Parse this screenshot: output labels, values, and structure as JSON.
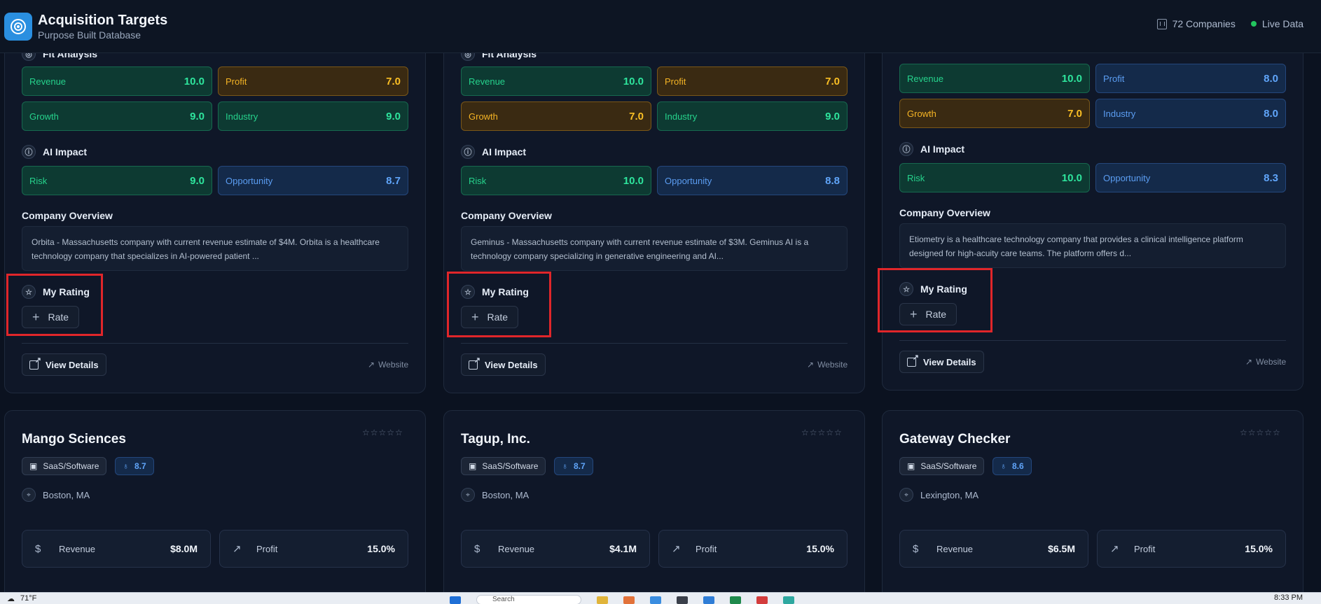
{
  "header": {
    "title": "Acquisition Targets",
    "subtitle": "Purpose Built Database",
    "companies_count": "72 Companies",
    "live_label": "Live Data"
  },
  "labels": {
    "fit_analysis": "Fit Analysis",
    "ai_impact": "AI Impact",
    "company_overview": "Company Overview",
    "my_rating": "My Rating",
    "rate": "Rate",
    "view_details": "View Details",
    "website": "Website",
    "revenue": "Revenue",
    "profit": "Profit",
    "growth": "Growth",
    "industry": "Industry",
    "risk": "Risk",
    "opportunity": "Opportunity"
  },
  "top_cards": [
    {
      "fit": {
        "revenue": "10.0",
        "profit": "7.0",
        "growth": "9.0",
        "industry": "9.0"
      },
      "ai": {
        "risk": "9.0",
        "opportunity": "8.7"
      },
      "overview": "Orbita - Massachusetts company with current revenue estimate of $4M. Orbita is a healthcare technology company that specializes in AI-powered patient ..."
    },
    {
      "fit": {
        "revenue": "10.0",
        "profit": "7.0",
        "growth": "7.0",
        "industry": "9.0"
      },
      "ai": {
        "risk": "10.0",
        "opportunity": "8.8"
      },
      "overview": "Geminus - Massachusetts company with current revenue estimate of $3M. Geminus AI is a technology company specializing in generative engineering and AI..."
    },
    {
      "fit": {
        "revenue": "10.0",
        "profit": "8.0",
        "growth": "7.0",
        "industry": "8.0"
      },
      "ai": {
        "risk": "10.0",
        "opportunity": "8.3"
      },
      "overview": "Etiometry is a healthcare technology company that provides a clinical intelligence platform designed for high-acuity care teams. The platform offers d..."
    }
  ],
  "bottom_cards": [
    {
      "name": "Mango Sciences",
      "sector": "SaaS/Software",
      "score": "8.7",
      "location": "Boston, MA",
      "revenue": "$8.0M",
      "profit": "15.0%"
    },
    {
      "name": "Tagup, Inc.",
      "sector": "SaaS/Software",
      "score": "8.7",
      "location": "Boston, MA",
      "revenue": "$4.1M",
      "profit": "15.0%"
    },
    {
      "name": "Gateway Checker",
      "sector": "SaaS/Software",
      "score": "8.6",
      "location": "Lexington, MA",
      "revenue": "$6.5M",
      "profit": "15.0%"
    }
  ],
  "taskbar": {
    "weather": "71°F",
    "search": "Search",
    "time": "8:33 PM"
  },
  "colors": {
    "green": "#2ee59d",
    "orange": "#fbbf24",
    "blue": "#60a5fa",
    "highlight": "#e0262a"
  }
}
